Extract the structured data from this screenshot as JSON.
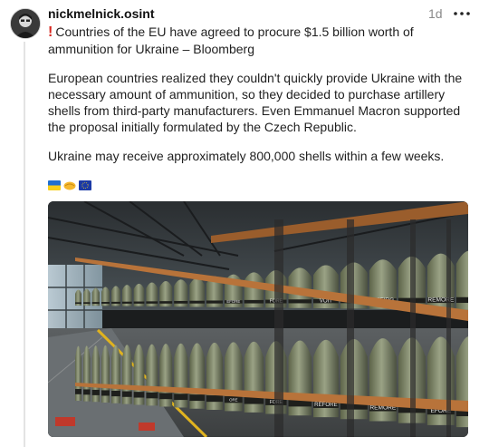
{
  "post": {
    "username": "nickmelnick.osint",
    "timestamp": "1d",
    "headline": "Countries of the EU have agreed to procure $1.5 billion worth of ammunition for Ukraine – Bloomberg",
    "paragraphs": [
      "European countries realized they couldn't quickly provide Ukraine with the necessary amount of ammunition, so they decided to purchase artillery shells from third-party manufacturers. Even Emmanuel Macron supported the proposal initially formulated by the Czech Republic.",
      "Ukraine may receive approximately 800,000 shells within a few weeks."
    ],
    "icons": {
      "exclamation": "red-exclamation-icon",
      "more": "more-options-icon",
      "emoji": [
        "ukraine-flag-icon",
        "handshake-icon",
        "eu-flag-icon"
      ]
    },
    "image": {
      "description_icon": "artillery-shell-warehouse-photo",
      "shell_label_fragments": [
        "EFORE",
        "FORE",
        "VOIT",
        "REFIRG",
        "REMORE",
        "ORE",
        "FORE",
        "REFORE",
        "REMORE",
        "EFORE",
        "OBEFORE"
      ]
    }
  },
  "colors": {
    "accent": "#d7261e",
    "muted": "#8a8a8a",
    "shell": "#7d8664"
  }
}
